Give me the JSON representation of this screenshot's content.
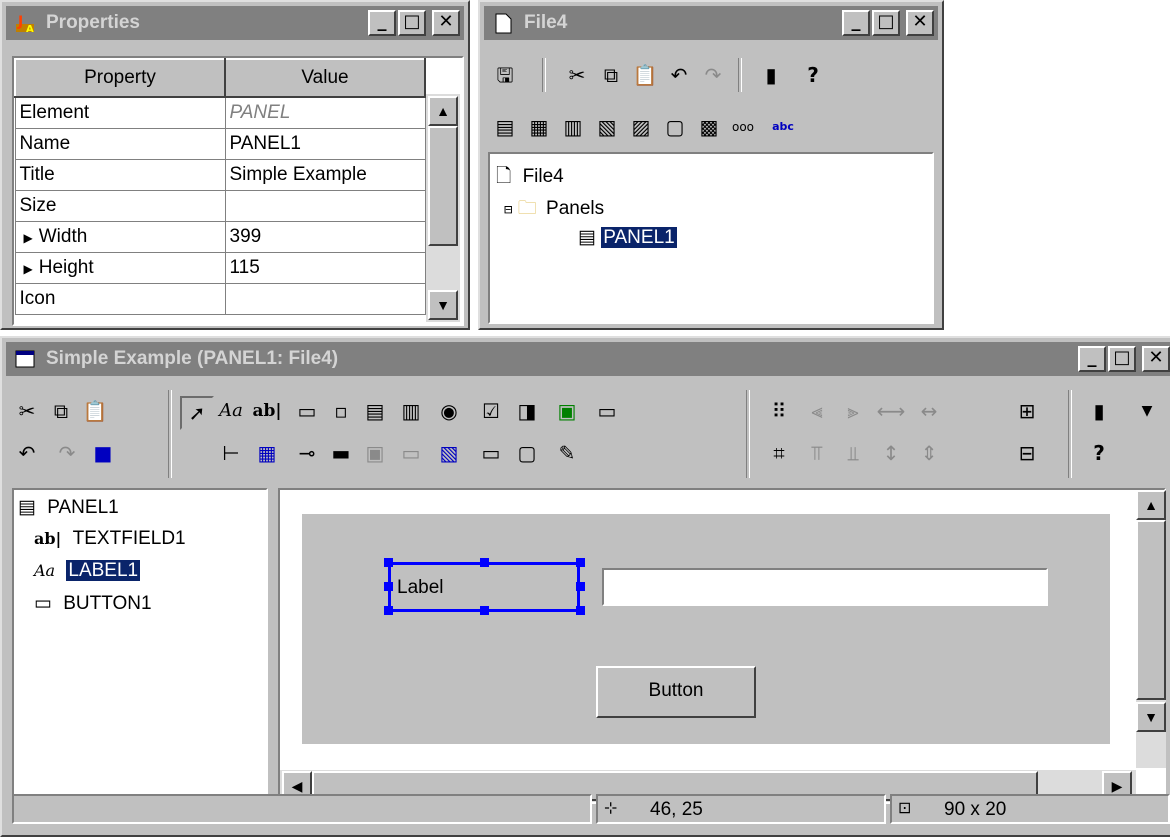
{
  "properties_window": {
    "title": "Properties",
    "columns": [
      "Property",
      "Value"
    ],
    "rows": [
      {
        "property": "Element",
        "value": "PANEL"
      },
      {
        "property": "Name",
        "value": "PANEL1"
      },
      {
        "property": "Title",
        "value": "Simple Example"
      },
      {
        "property": "Size",
        "value": ""
      },
      {
        "property": "Width",
        "value": "399"
      },
      {
        "property": "Height",
        "value": "115"
      },
      {
        "property": "Icon",
        "value": ""
      }
    ]
  },
  "file_window": {
    "title": "File4",
    "tree": {
      "root": "File4",
      "folder": "Panels",
      "panel": "PANEL1"
    }
  },
  "editor_window": {
    "title": "Simple Example (PANEL1: File4)",
    "tree": {
      "root": "PANEL1",
      "items": [
        "TEXTFIELD1",
        "LABEL1",
        "BUTTON1"
      ]
    },
    "canvas": {
      "label_text": "Label",
      "button_text": "Button",
      "textfield_value": ""
    },
    "status": {
      "position": "46, 25",
      "size": "90 x 20"
    },
    "text_icons": {
      "label_tool": "Aa",
      "textfield_tool": "ab|"
    }
  },
  "colors": {
    "window_bg": "#c0c0c0",
    "title_inactive": "#808080",
    "selection": "#0a246a",
    "handles": "#0000ff"
  }
}
